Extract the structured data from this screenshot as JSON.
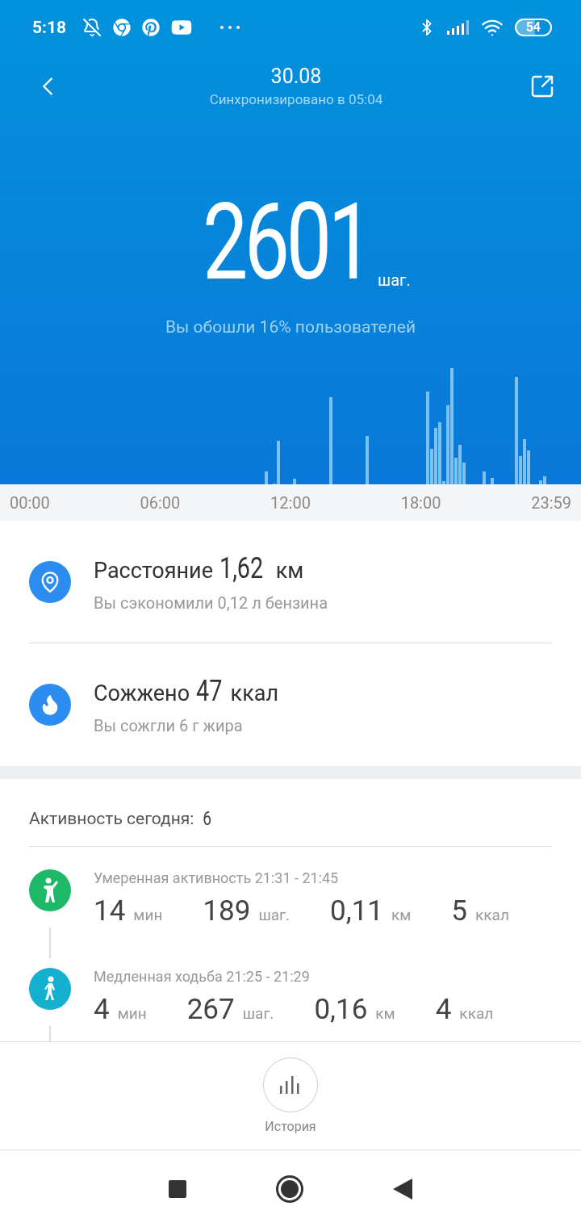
{
  "status_bar": {
    "time": "5:18",
    "battery": "54"
  },
  "header": {
    "title": "30.08",
    "subtitle": "Синхронизировано в 05:04"
  },
  "steps": {
    "value": "2601",
    "unit": "шаг.",
    "comparison": "Вы обошли 16% пользователей"
  },
  "timeline": {
    "labels": [
      "00:00",
      "06:00",
      "12:00",
      "18:00",
      "23:59"
    ]
  },
  "summary": [
    {
      "kind": "distance",
      "label": "Расстояние",
      "value": "1,62",
      "unit": "км",
      "note": "Вы сэкономили 0,12 л бензина"
    },
    {
      "kind": "calories",
      "label": "Сожжено",
      "value": "47",
      "unit": "ккал",
      "note": "Вы сожгли 6 г жира"
    }
  ],
  "activity": {
    "title": "Активность сегодня:",
    "count": "6",
    "items": [
      {
        "kind": "moderate",
        "color": "#1db868",
        "title": "Умеренная активность 21:31 - 21:45",
        "stats": [
          {
            "value": "14",
            "unit": "мин"
          },
          {
            "value": "189",
            "unit": "шаг."
          },
          {
            "value": "0,11",
            "unit": "км"
          },
          {
            "value": "5",
            "unit": "ккал"
          }
        ]
      },
      {
        "kind": "walk",
        "color": "#13b0d0",
        "title": "Медленная ходьба 21:25 - 21:29",
        "stats": [
          {
            "value": "4",
            "unit": "мин"
          },
          {
            "value": "267",
            "unit": "шаг."
          },
          {
            "value": "0,16",
            "unit": "км"
          },
          {
            "value": "4",
            "unit": "ккал"
          }
        ]
      }
    ]
  },
  "history_button": {
    "label": "История"
  }
}
